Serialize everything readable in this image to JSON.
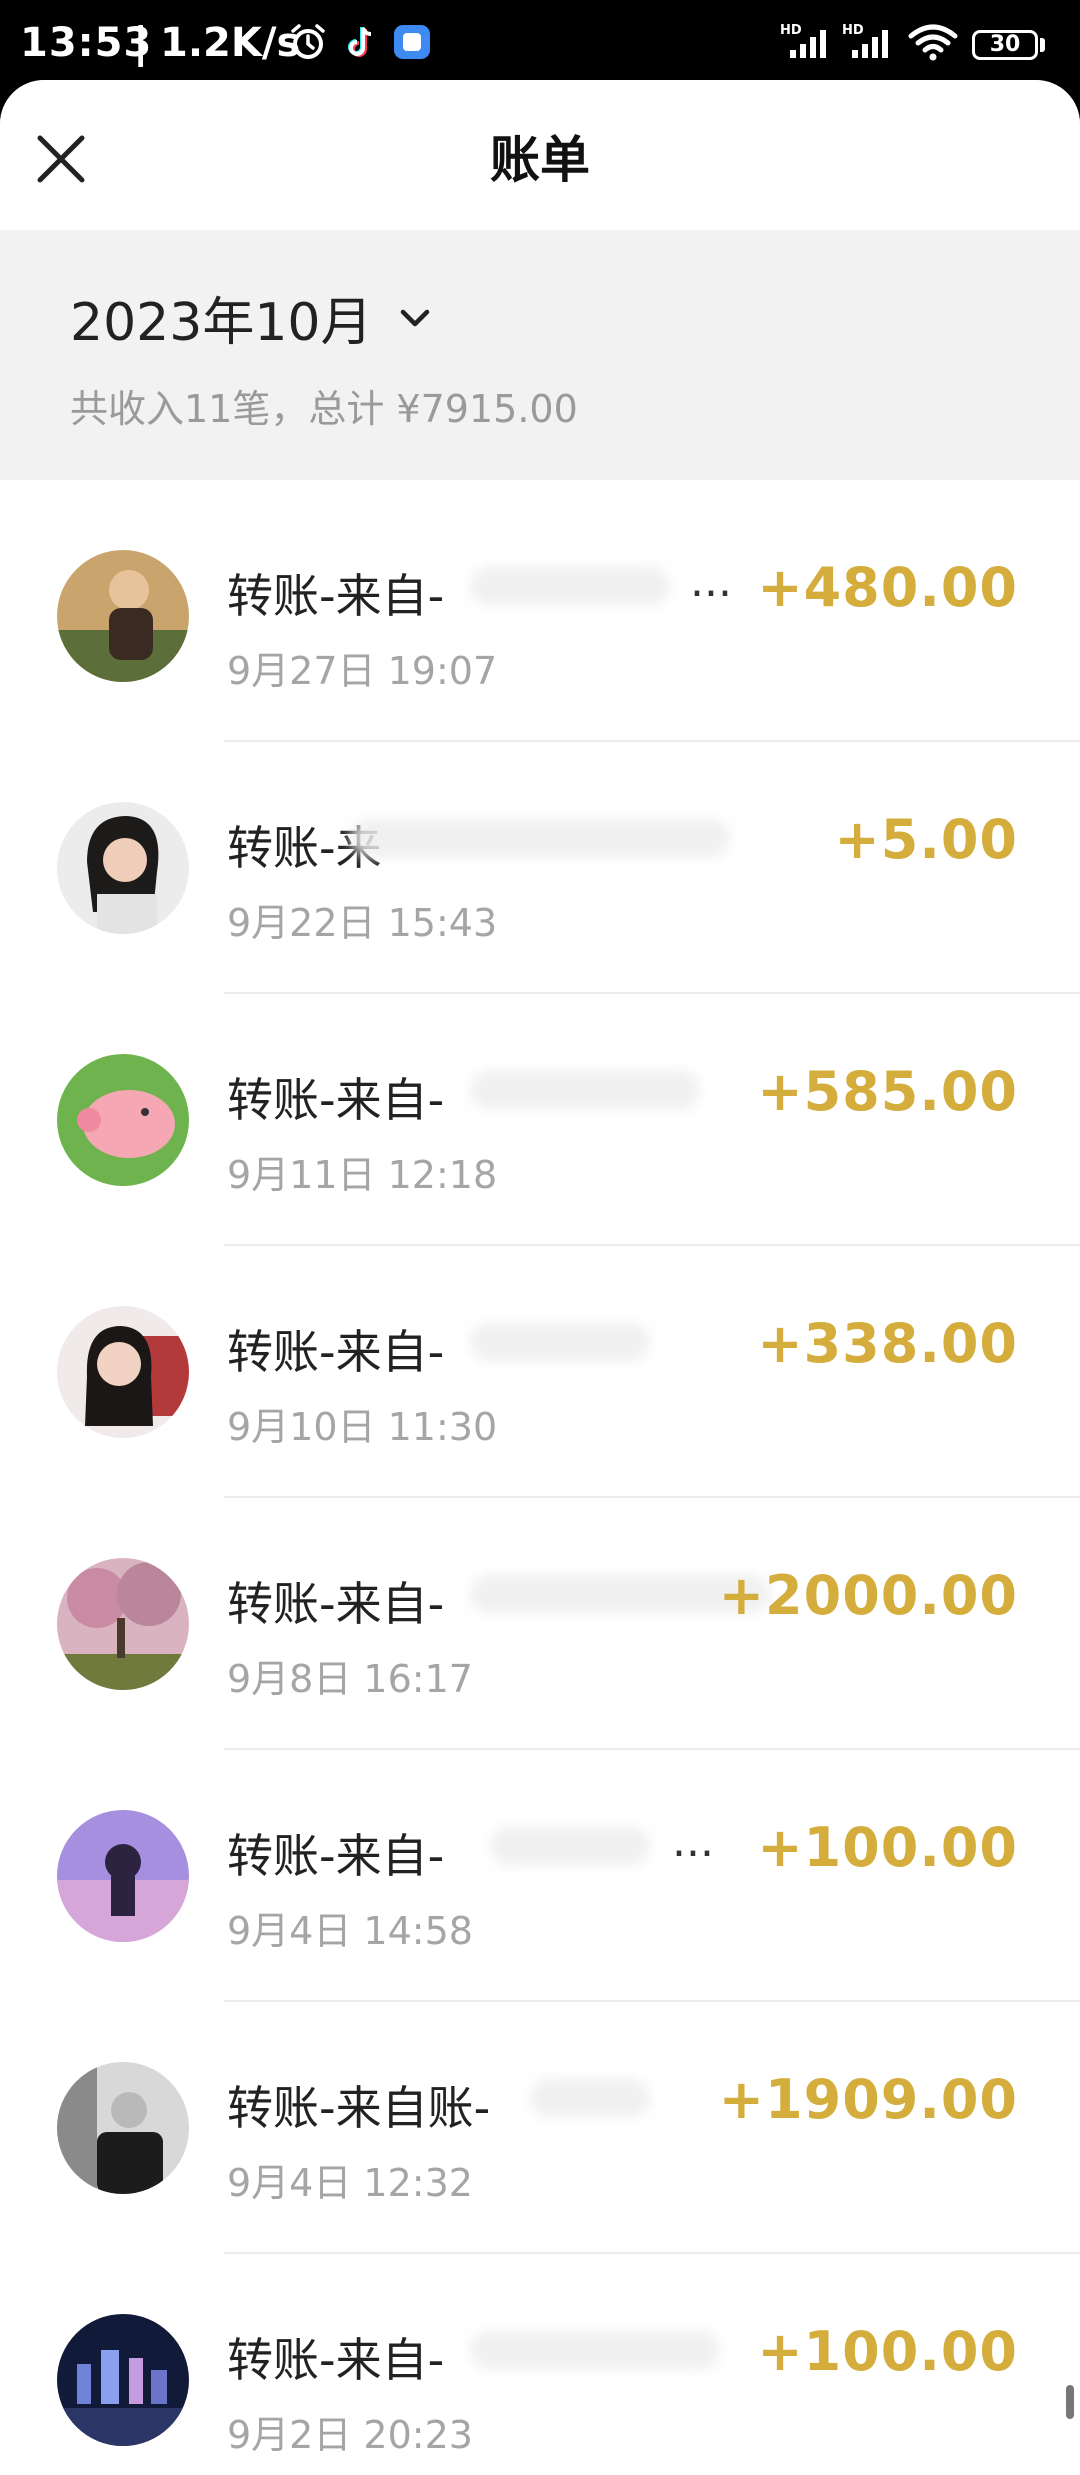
{
  "status_bar": {
    "time": "13:53",
    "separator": "|",
    "speed": "1.2K/s",
    "battery": "30",
    "icons": [
      "alarm-icon",
      "tiktok-icon",
      "app-icon",
      "hd-signal-icon",
      "hd-signal-icon",
      "wifi-icon",
      "battery-icon"
    ]
  },
  "nav": {
    "title": "账单",
    "close_icon": "close-icon"
  },
  "summary": {
    "month": "2023年10月",
    "text": "共收入11笔，总计 ¥7915.00"
  },
  "transactions": [
    {
      "title": "转账-来自-",
      "time": "9月27日 19:07",
      "amount": "+480.00",
      "ellipsis": "..."
    },
    {
      "title": "转账-来",
      "time": "9月22日 15:43",
      "amount": "+5.00",
      "ellipsis": ""
    },
    {
      "title": "转账-来自-",
      "time": "9月11日 12:18",
      "amount": "+585.00",
      "ellipsis": ""
    },
    {
      "title": "转账-来自-",
      "time": "9月10日 11:30",
      "amount": "+338.00",
      "ellipsis": ""
    },
    {
      "title": "转账-来自-",
      "time": "9月8日 16:17",
      "amount": "+2000.00",
      "ellipsis": ""
    },
    {
      "title": "转账-来自-",
      "time": "9月4日 14:58",
      "amount": "+100.00",
      "ellipsis": "..."
    },
    {
      "title": "转账-来自账-",
      "time": "9月4日 12:32",
      "amount": "+1909.00",
      "ellipsis": ""
    },
    {
      "title": "转账-来自-",
      "time": "9月2日 20:23",
      "amount": "+100.00",
      "ellipsis": ""
    }
  ],
  "colors": {
    "amount": "#d4ad3c",
    "summary_bg": "#f2f2f2",
    "secondary_text": "#9a9a9a"
  }
}
